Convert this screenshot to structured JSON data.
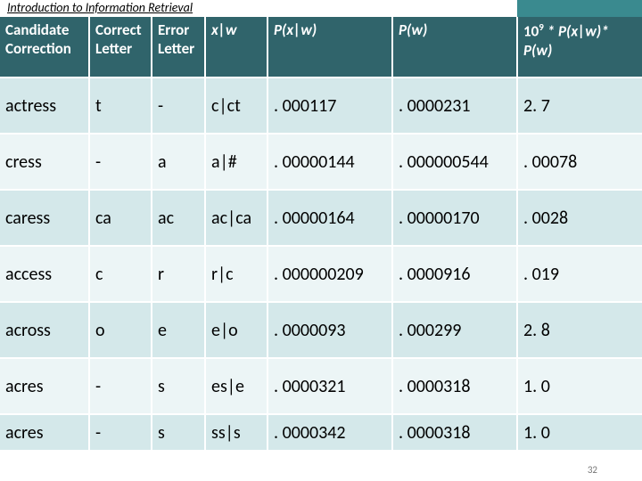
{
  "breadcrumb": "Introduction to Information Retrieval",
  "header": {
    "c1": "Candidate Correction",
    "c2": "Correct Letter",
    "c3": "Error Letter",
    "c4": "x|w",
    "c5": "P(x|w)",
    "c6": "P(w)",
    "c7_pre": "10",
    "c7_sup": "9",
    "c7_post": " * P(x|w)* P(w)"
  },
  "rows": [
    {
      "cand": "actress",
      "corr": "t",
      "err": "-",
      "xw": "c|ct",
      "pxw": ". 000117",
      "pw": ". 0000231",
      "prod": "2. 7"
    },
    {
      "cand": "cress",
      "corr": "-",
      "err": "a",
      "xw": "a|#",
      "pxw": ". 00000144",
      "pw": ". 000000544",
      "prod": ". 00078"
    },
    {
      "cand": "caress",
      "corr": "ca",
      "err": "ac",
      "xw": "ac|ca",
      "pxw": ". 00000164",
      "pw": ". 00000170",
      "prod": ". 0028"
    },
    {
      "cand": "access",
      "corr": "c",
      "err": "r",
      "xw": "r|c",
      "pxw": ". 000000209",
      "pw": ". 0000916",
      "prod": ". 019"
    },
    {
      "cand": "across",
      "corr": "o",
      "err": "e",
      "xw": "e|o",
      "pxw": ". 0000093",
      "pw": ". 000299",
      "prod": "2. 8"
    },
    {
      "cand": "acres",
      "corr": "-",
      "err": "s",
      "xw": "es|e",
      "pxw": ". 0000321",
      "pw": ". 0000318",
      "prod": "1. 0"
    },
    {
      "cand": "acres",
      "corr": "-",
      "err": "s",
      "xw": "ss|s",
      "pxw": ". 0000342",
      "pw": ". 0000318",
      "prod": "1. 0"
    }
  ],
  "chart_data": {
    "type": "table",
    "title": "Spelling correction candidate scoring",
    "columns": [
      "Candidate Correction",
      "Correct Letter",
      "Error Letter",
      "x|w",
      "P(x|w)",
      "P(w)",
      "10^9 * P(x|w)*P(w)"
    ],
    "rows": [
      [
        "actress",
        "t",
        "-",
        "c|ct",
        0.000117,
        2.31e-05,
        2.7
      ],
      [
        "cress",
        "-",
        "a",
        "a|#",
        1.44e-06,
        5.44e-07,
        0.00078
      ],
      [
        "caress",
        "ca",
        "ac",
        "ac|ca",
        1.64e-06,
        1.7e-06,
        0.0028
      ],
      [
        "access",
        "c",
        "r",
        "r|c",
        2.09e-07,
        9.16e-05,
        0.019
      ],
      [
        "across",
        "o",
        "e",
        "e|o",
        9.3e-06,
        0.000299,
        2.8
      ],
      [
        "acres",
        "-",
        "s",
        "es|e",
        3.21e-05,
        3.18e-05,
        1.0
      ],
      [
        "acres",
        "-",
        "s",
        "ss|s",
        3.42e-05,
        3.18e-05,
        1.0
      ]
    ]
  },
  "page_number": "32"
}
